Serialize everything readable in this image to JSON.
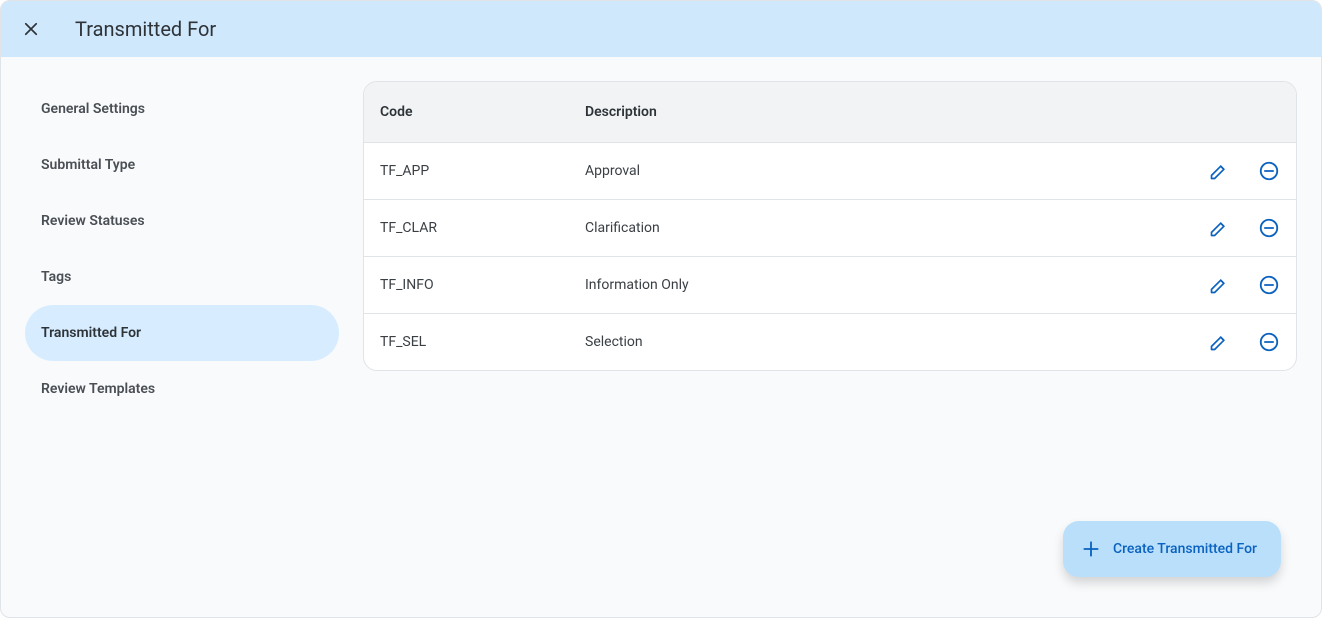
{
  "header": {
    "title": "Transmitted For"
  },
  "sidebar": {
    "items": [
      {
        "label": "General Settings",
        "active": false
      },
      {
        "label": "Submittal Type",
        "active": false
      },
      {
        "label": "Review Statuses",
        "active": false
      },
      {
        "label": "Tags",
        "active": false
      },
      {
        "label": "Transmitted For",
        "active": true
      },
      {
        "label": "Review Templates",
        "active": false
      }
    ]
  },
  "table": {
    "headers": {
      "code": "Code",
      "description": "Description"
    },
    "rows": [
      {
        "code": "TF_APP",
        "description": "Approval"
      },
      {
        "code": "TF_CLAR",
        "description": "Clarification"
      },
      {
        "code": "TF_INFO",
        "description": "Information Only"
      },
      {
        "code": "TF_SEL",
        "description": "Selection"
      }
    ]
  },
  "create_button": {
    "label": "Create Transmitted For"
  }
}
